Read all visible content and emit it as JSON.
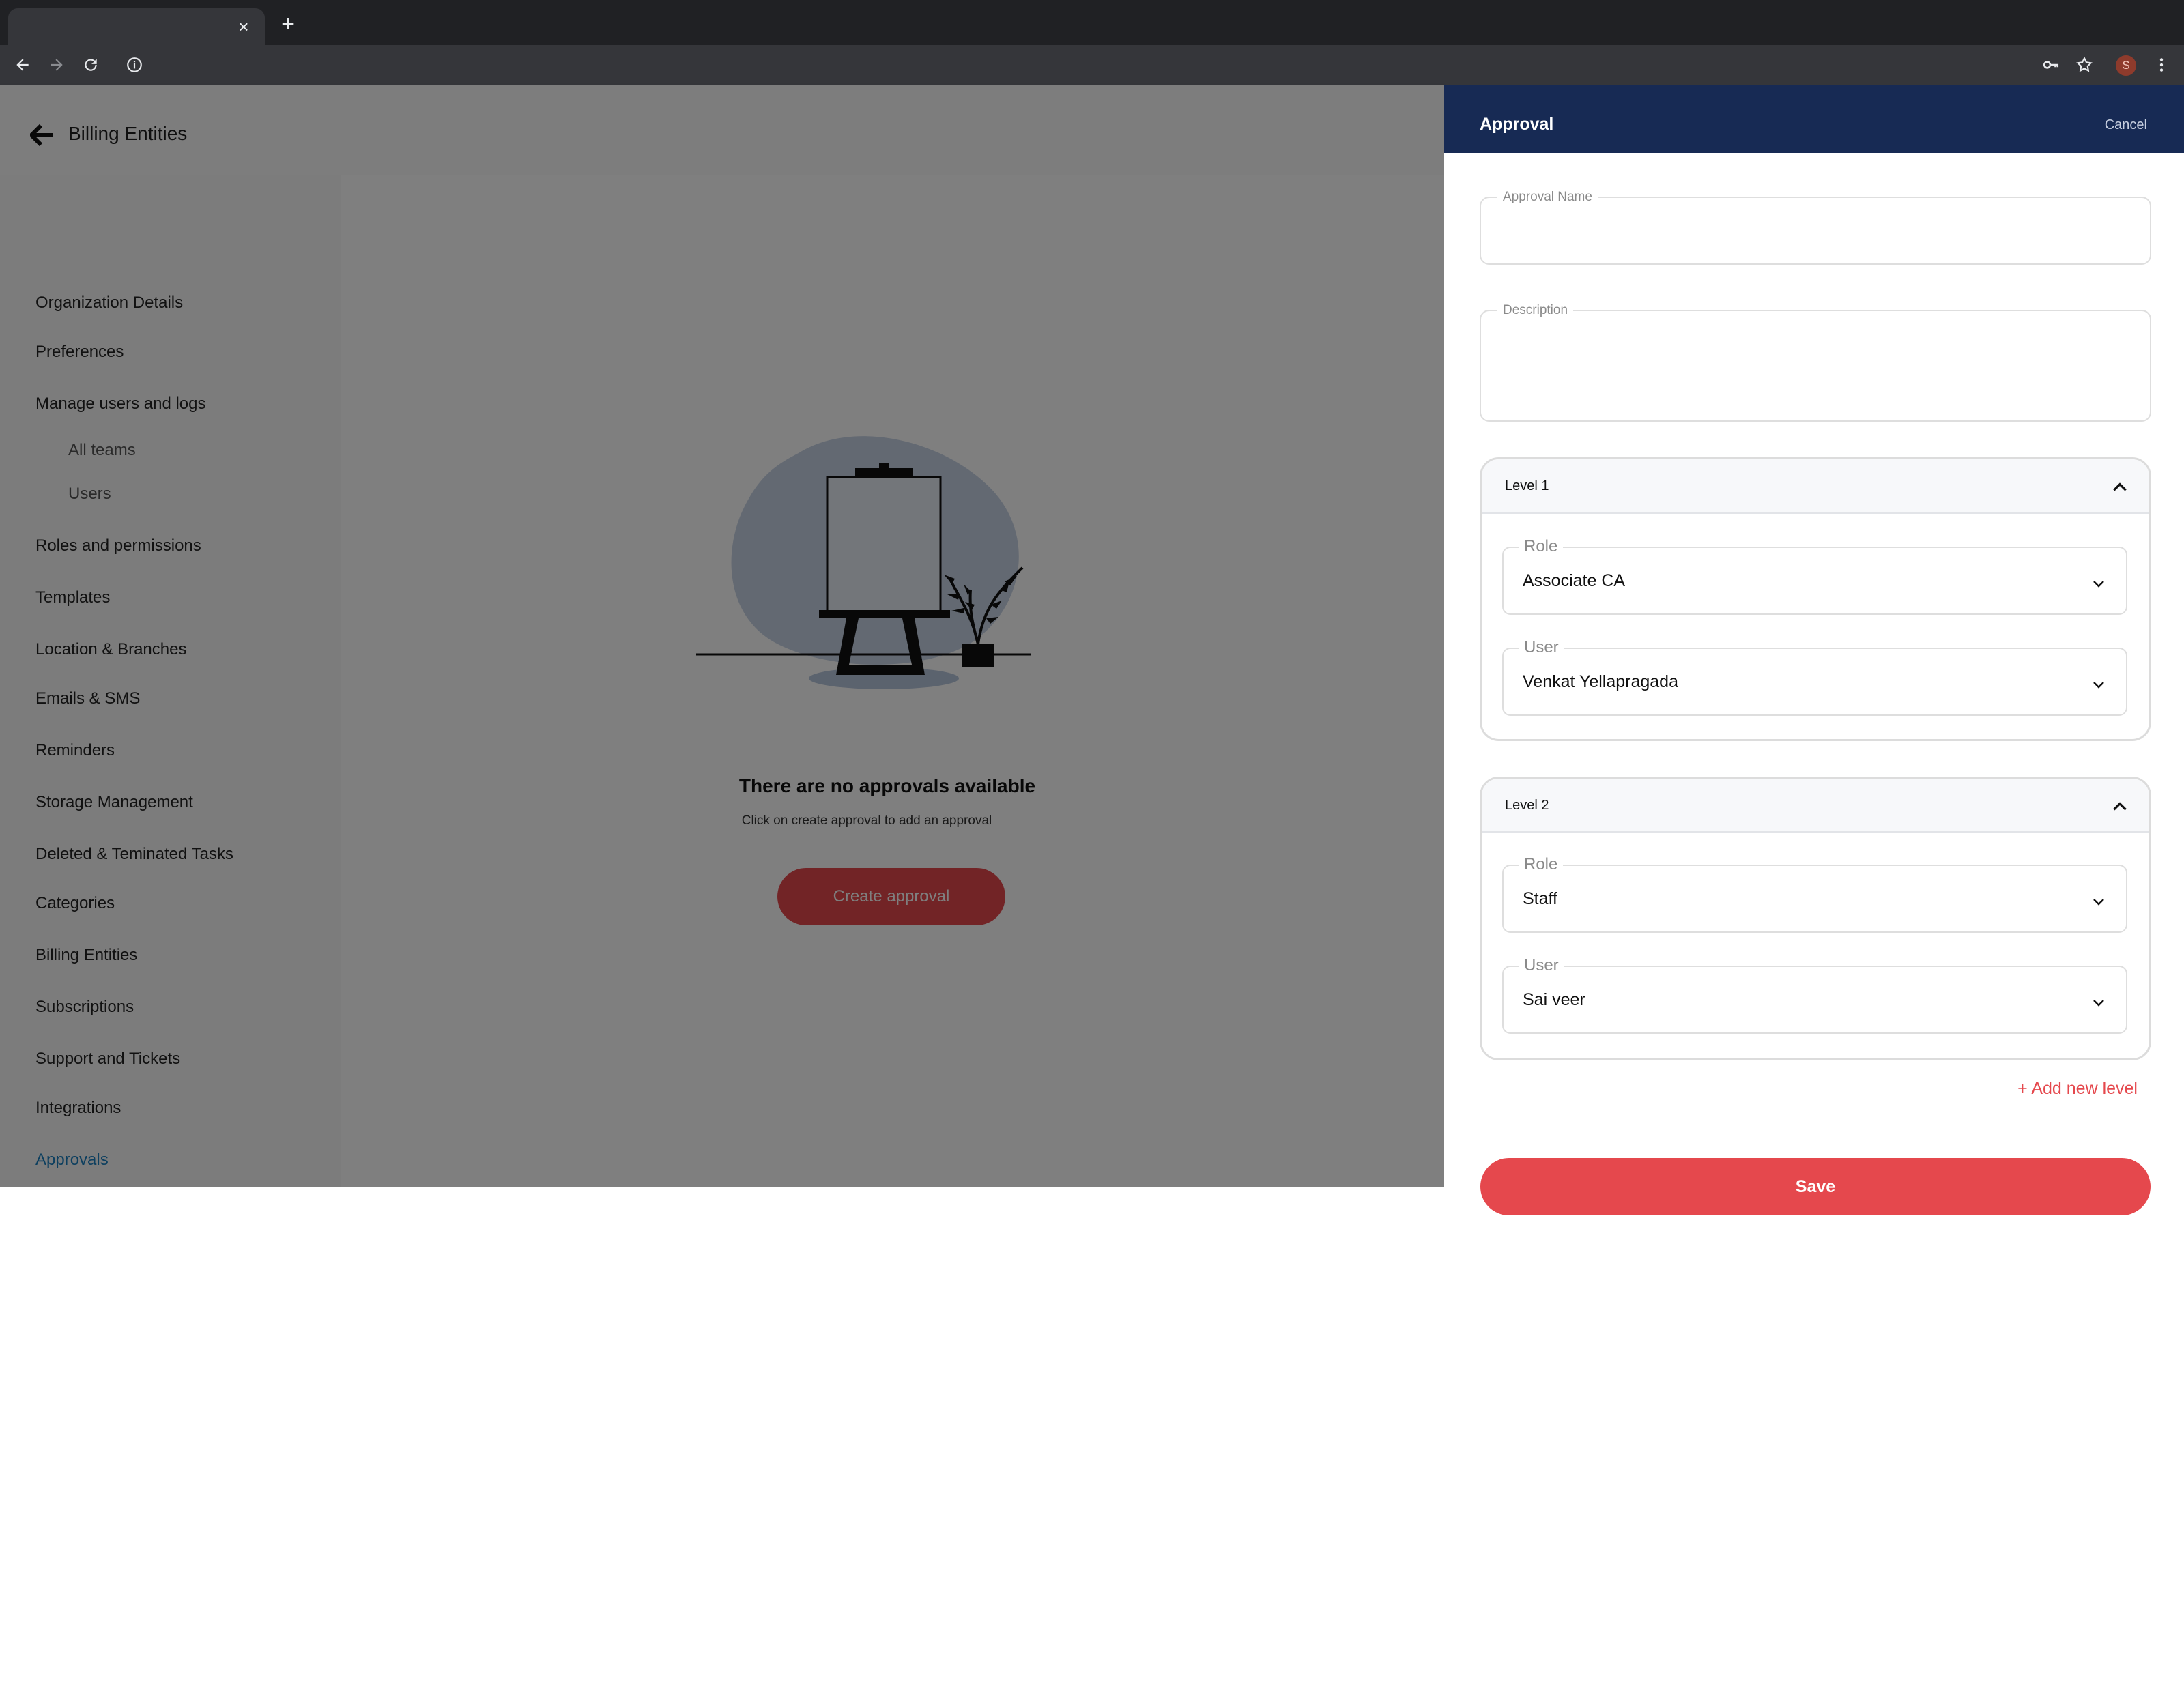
{
  "browser": {
    "tab_close": "×",
    "new_tab": "+",
    "profile_initial": "S"
  },
  "header": {
    "title": "Billing Entities"
  },
  "sidebar": {
    "items": [
      {
        "label": "Organization Details"
      },
      {
        "label": "Preferences"
      },
      {
        "label": "Manage users and logs"
      },
      {
        "label": "All teams"
      },
      {
        "label": "Users"
      },
      {
        "label": "Roles and permissions"
      },
      {
        "label": "Templates"
      },
      {
        "label": "Location & Branches"
      },
      {
        "label": "Emails & SMS"
      },
      {
        "label": "Reminders"
      },
      {
        "label": "Storage Management"
      },
      {
        "label": "Deleted & Teminated Tasks"
      },
      {
        "label": "Categories"
      },
      {
        "label": "Billing Entities"
      },
      {
        "label": "Subscriptions"
      },
      {
        "label": "Support and Tickets"
      },
      {
        "label": "Integrations"
      },
      {
        "label": "Approvals"
      }
    ],
    "active_color": "#1a7fbf"
  },
  "empty_state": {
    "title": "There are no approvals available",
    "subtitle": "Click on create approval to add an approval",
    "button": "Create approval"
  },
  "drawer": {
    "title": "Approval",
    "cancel": "Cancel",
    "approval_name_label": "Approval Name",
    "approval_name_value": "",
    "description_label": "Description",
    "description_value": "",
    "levels": [
      {
        "title": "Level 1",
        "role_label": "Role",
        "role_value": "Associate CA",
        "user_label": "User",
        "user_value": "Venkat Yellapragada"
      },
      {
        "title": "Level 2",
        "role_label": "Role",
        "role_value": "Staff",
        "user_label": "User",
        "user_value": "Sai veer"
      }
    ],
    "add_level": "+ Add new level",
    "save": "Save",
    "header_color": "#172a54",
    "accent_color": "#e5484d"
  }
}
